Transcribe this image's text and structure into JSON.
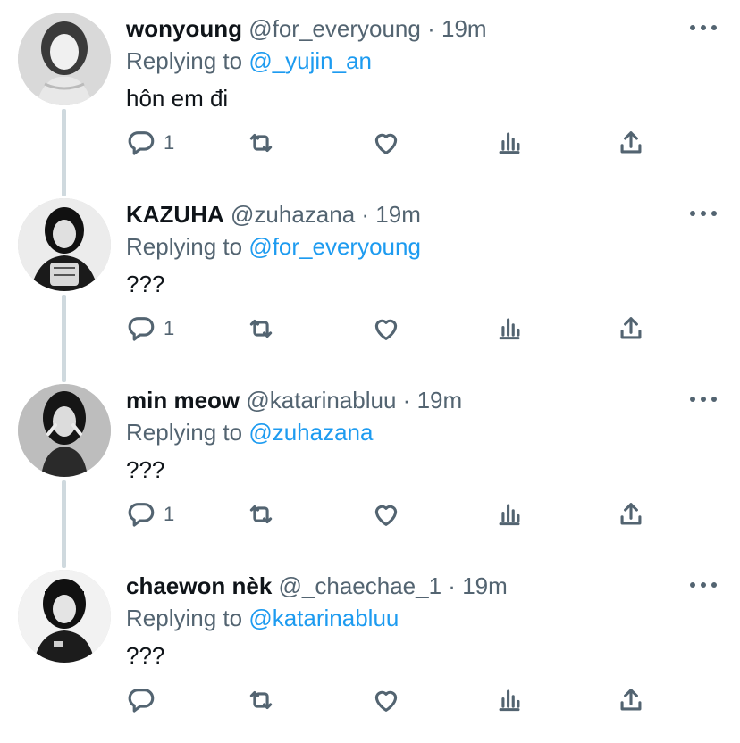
{
  "tweets": [
    {
      "display_name": "wonyoung",
      "handle": "@for_everyoung",
      "separator": "·",
      "time": "19m",
      "replying_label": "Replying to",
      "replying_to": "@_yujin_an",
      "text": "hôn em đi",
      "reply_count": "1",
      "avatar": "avatar-wonyoung"
    },
    {
      "display_name": "KAZUHA",
      "handle": "@zuhazana",
      "separator": "·",
      "time": "19m",
      "replying_label": "Replying to",
      "replying_to": "@for_everyoung",
      "text": "???",
      "reply_count": "1",
      "avatar": "avatar-kazuha"
    },
    {
      "display_name": "min meow",
      "handle": "@katarinabluu",
      "separator": "·",
      "time": "19m",
      "replying_label": "Replying to",
      "replying_to": "@zuhazana",
      "text": "???",
      "reply_count": "1",
      "avatar": "avatar-min-meow"
    },
    {
      "display_name": "chaewon nèk",
      "handle": "@_chaechae_1",
      "separator": "·",
      "time": "19m",
      "replying_label": "Replying to",
      "replying_to": "@katarinabluu",
      "text": "???",
      "reply_count": "",
      "avatar": "avatar-chaewon"
    }
  ],
  "colors": {
    "text": "#0f1419",
    "secondary": "#536471",
    "link": "#1d9bf0",
    "thread_line": "#cfd9de"
  },
  "icons": [
    "reply-icon",
    "retweet-icon",
    "like-icon",
    "analytics-icon",
    "share-icon",
    "more-options-icon"
  ]
}
